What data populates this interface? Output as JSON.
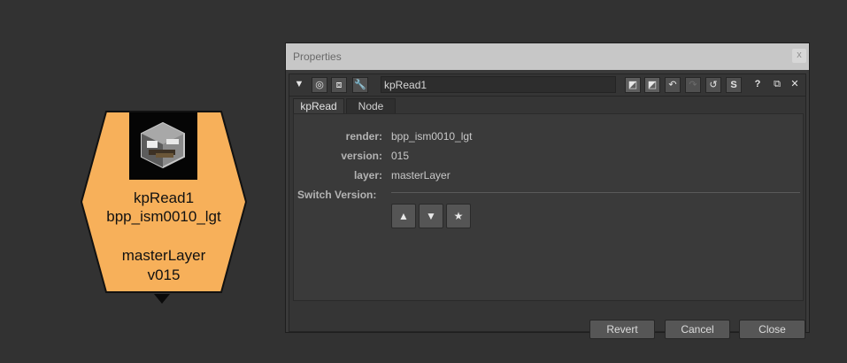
{
  "node": {
    "title": "kpRead1",
    "render": "bpp_ism0010_lgt",
    "layer": "masterLayer",
    "version_label": "v015",
    "fill_color": "#f7b05a",
    "thumbnail_icon": "package-box-icon"
  },
  "window": {
    "title": "Properties",
    "close_glyph": "x"
  },
  "toolbar": {
    "collapse_glyph": "▼",
    "center_glyph": "◎",
    "viewer_glyph": "⧈",
    "settings_glyph": "🔧",
    "node_name": "kpRead1",
    "color1_glyph": "◩",
    "color2_glyph": "◩",
    "undo_glyph": "↶",
    "redo_glyph": "↷",
    "revert_glyph": "↺",
    "s_label": "S",
    "help_glyph": "?",
    "float_glyph": "⧉",
    "close_glyph": "✕"
  },
  "tabs": [
    "kpRead",
    "Node"
  ],
  "knobs": {
    "render_label": "render:",
    "render_value": "bpp_ism0010_lgt",
    "version_label": "version:",
    "version_value": "015",
    "layer_label": "layer:",
    "layer_value": "masterLayer",
    "switch_version_label": "Switch Version:",
    "up_glyph": "▲",
    "down_glyph": "▼",
    "latest_glyph": "★"
  },
  "footer": {
    "revert": "Revert",
    "cancel": "Cancel",
    "close": "Close"
  }
}
